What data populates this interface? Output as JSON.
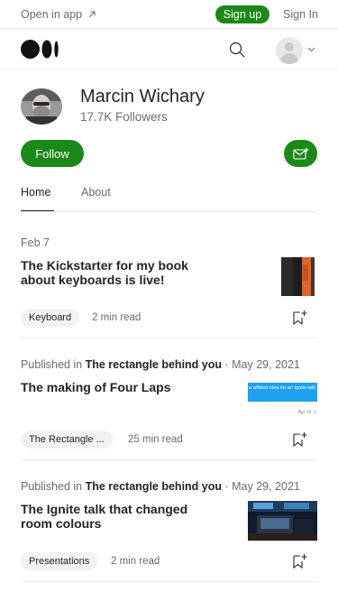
{
  "topbar": {
    "open_in_app": "Open in app",
    "signup": "Sign up",
    "signin": "Sign In"
  },
  "profile": {
    "name": "Marcin Wichary",
    "followers": "17.7K Followers",
    "follow_label": "Follow"
  },
  "tabs": [
    {
      "label": "Home",
      "active": true
    },
    {
      "label": "About",
      "active": false
    }
  ],
  "colors": {
    "brand_green": "#1a8917",
    "text": "#242424",
    "muted": "#6b6b6b"
  },
  "articles": [
    {
      "date": "Feb 7",
      "title": "The Kickstarter for my book about keyboards is live!",
      "tag": "Keyboard",
      "read_time": "2 min read"
    },
    {
      "published_in_prefix": "Published in",
      "publication": "The rectangle behind you",
      "date": "· May 29, 2021",
      "title": "The making of Four Laps",
      "tag": "The Rectangle ...",
      "read_time": "25 min read",
      "thumb_text": "e wildest idea for an Ignite talk",
      "thumb_date": "Apr 16, 2"
    },
    {
      "published_in_prefix": "Published in",
      "publication": "The rectangle behind you",
      "date": "· May 29, 2021",
      "title": "The Ignite talk that changed room colours",
      "tag": "Presentations",
      "read_time": "2 min read"
    }
  ]
}
